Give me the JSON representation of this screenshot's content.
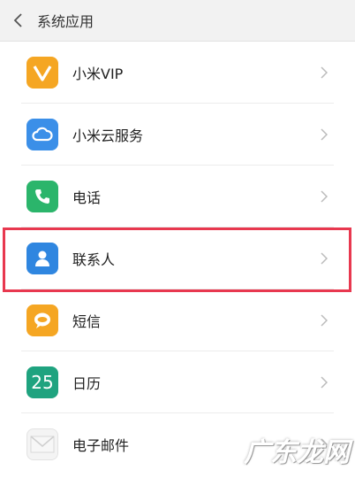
{
  "header": {
    "title": "系统应用",
    "back_icon": "chevron-left-icon"
  },
  "items": [
    {
      "label": "小米VIP",
      "icon": "vip-icon",
      "color": "#f5a623"
    },
    {
      "label": "小米云服务",
      "icon": "cloud-icon",
      "color": "#3b8fe8"
    },
    {
      "label": "电话",
      "icon": "phone-icon",
      "color": "#2bb56b"
    },
    {
      "label": "联系人",
      "icon": "contact-icon",
      "color": "#2f86e0"
    },
    {
      "label": "短信",
      "icon": "message-icon",
      "color": "#f5a623"
    },
    {
      "label": "日历",
      "icon": "calendar-icon",
      "color": "#1fa37f",
      "icon_text": "25"
    },
    {
      "label": "电子邮件",
      "icon": "mail-icon",
      "color": "#eeeeee"
    }
  ],
  "highlight_color": "#e8384f",
  "watermark": "广东龙网"
}
